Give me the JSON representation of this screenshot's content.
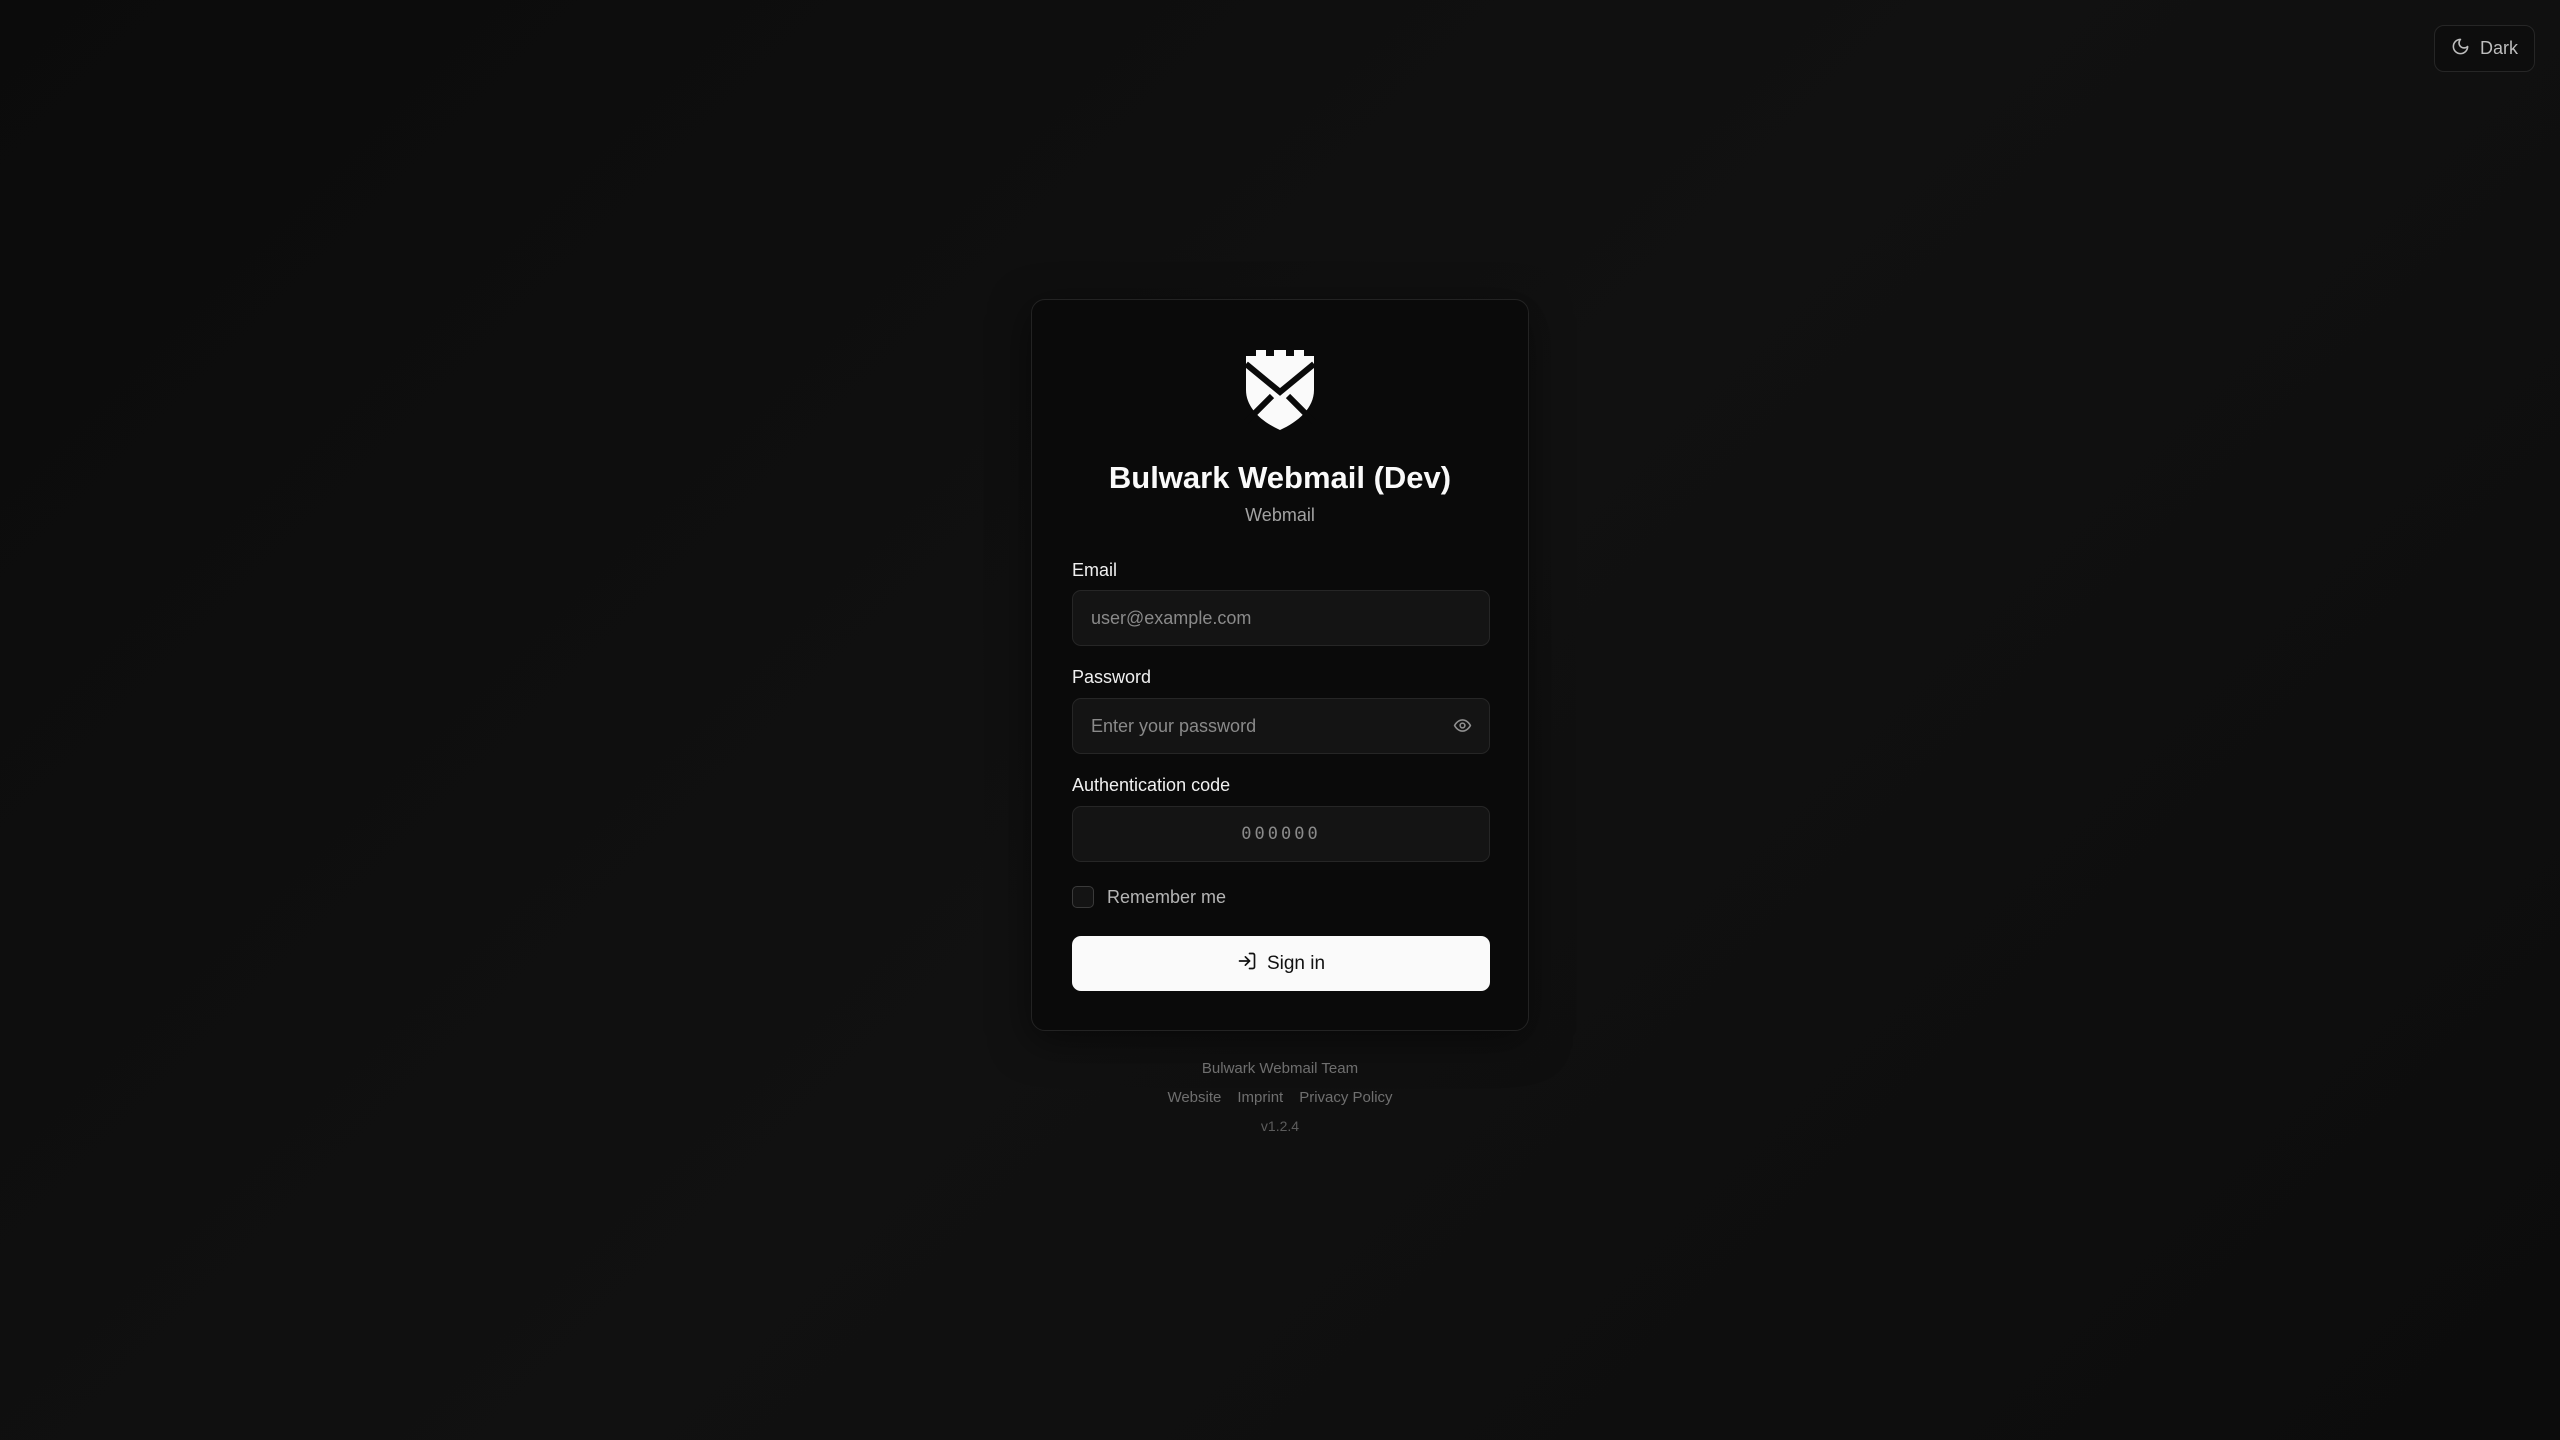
{
  "theme_toggle": {
    "label": "Dark",
    "icon": "moon-icon"
  },
  "brand": {
    "title": "Bulwark Webmail (Dev)",
    "subtitle": "Webmail",
    "logo_icon": "shield-envelope-icon"
  },
  "form": {
    "email": {
      "label": "Email",
      "value": "",
      "placeholder": "user@example.com"
    },
    "password": {
      "label": "Password",
      "value": "",
      "placeholder": "Enter your password",
      "toggle_icon": "eye-icon"
    },
    "auth_code": {
      "label": "Authentication code",
      "value": "",
      "placeholder": "000000"
    },
    "remember": {
      "label": "Remember me",
      "checked": false
    },
    "submit": {
      "label": "Sign in",
      "icon": "log-in-icon"
    }
  },
  "footer": {
    "team": "Bulwark Webmail Team",
    "links": [
      "Website",
      "Imprint",
      "Privacy Policy"
    ],
    "version": "v1.2.4"
  },
  "colors": {
    "background": "#0b0b0b",
    "card": "#0a0a0a",
    "input": "#141414",
    "button": "#fafafa",
    "button_text": "#111111"
  }
}
